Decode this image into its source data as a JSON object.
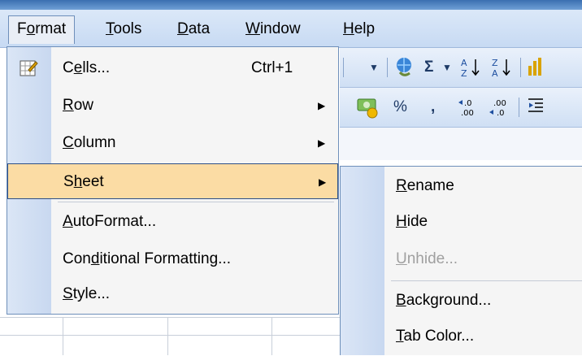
{
  "menubar": {
    "items": [
      {
        "id": "format",
        "label": "Format",
        "ul_pre": "F",
        "ul_char": "o",
        "ul_post": "rmat",
        "active": true
      },
      {
        "id": "tools",
        "label": "Tools",
        "ul_pre": "",
        "ul_char": "T",
        "ul_post": "ools",
        "active": false
      },
      {
        "id": "data",
        "label": "Data",
        "ul_pre": "",
        "ul_char": "D",
        "ul_post": "ata",
        "active": false
      },
      {
        "id": "window",
        "label": "Window",
        "ul_pre": "",
        "ul_char": "W",
        "ul_post": "indow",
        "active": false
      },
      {
        "id": "help",
        "label": "Help",
        "ul_pre": "",
        "ul_char": "H",
        "ul_post": "elp",
        "active": false
      }
    ]
  },
  "format_menu": {
    "items": [
      {
        "id": "cells",
        "label": "Cells...",
        "ul_pre": "C",
        "ul_char": "e",
        "ul_post": "lls...",
        "shortcut": "Ctrl+1",
        "submenu": false,
        "icon": "format-cells-icon"
      },
      {
        "id": "row",
        "label": "Row",
        "ul_pre": "",
        "ul_char": "R",
        "ul_post": "ow",
        "shortcut": "",
        "submenu": true
      },
      {
        "id": "column",
        "label": "Column",
        "ul_pre": "",
        "ul_char": "C",
        "ul_post": "olumn",
        "shortcut": "",
        "submenu": true
      },
      {
        "id": "sheet",
        "label": "Sheet",
        "ul_pre": "S",
        "ul_char": "h",
        "ul_post": "eet",
        "shortcut": "",
        "submenu": true,
        "highlighted": true
      },
      {
        "id": "autoformat",
        "label": "AutoFormat...",
        "ul_pre": "",
        "ul_char": "A",
        "ul_post": "utoFormat...",
        "shortcut": "",
        "submenu": false
      },
      {
        "id": "conditional",
        "label": "Conditional Formatting...",
        "ul_pre": "Con",
        "ul_char": "d",
        "ul_post": "itional Formatting...",
        "shortcut": "",
        "submenu": false
      },
      {
        "id": "style",
        "label": "Style...",
        "ul_pre": "",
        "ul_char": "S",
        "ul_post": "tyle...",
        "shortcut": "",
        "submenu": false
      }
    ]
  },
  "sheet_submenu": {
    "items": [
      {
        "id": "rename",
        "label": "Rename",
        "ul_pre": "",
        "ul_char": "R",
        "ul_post": "ename",
        "disabled": false
      },
      {
        "id": "hide",
        "label": "Hide",
        "ul_pre": "",
        "ul_char": "H",
        "ul_post": "ide",
        "disabled": false
      },
      {
        "id": "unhide",
        "label": "Unhide...",
        "ul_pre": "",
        "ul_char": "U",
        "ul_post": "nhide...",
        "disabled": true
      },
      {
        "id": "background",
        "label": "Background...",
        "ul_pre": "",
        "ul_char": "B",
        "ul_post": "ackground...",
        "disabled": false
      },
      {
        "id": "tabcolor",
        "label": "Tab Color...",
        "ul_pre": "",
        "ul_char": "T",
        "ul_post": "ab Color...",
        "disabled": false
      }
    ]
  },
  "toolbar": {
    "standard_glyphs": [
      "│",
      "↓",
      "│",
      "Σ",
      "↓",
      "A↓Z",
      "Z↓A",
      "│"
    ],
    "formatting_glyphs": [
      "%",
      ",",
      ".00→.0",
      ".0→.00",
      "│"
    ]
  },
  "colors": {
    "menu_highlight": "#fbdca4",
    "menu_border": "#6e8fba",
    "disabled_text": "#a0a0a0"
  }
}
